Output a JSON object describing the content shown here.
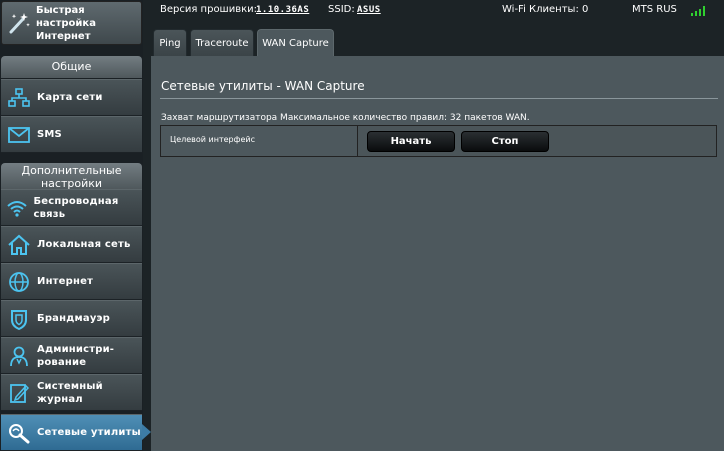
{
  "sidebar": {
    "quick_setup_label": "Быстрая настройка Интернет",
    "general_header": "Общие",
    "general_items": [
      {
        "label": "Карта сети",
        "icon": "network-map-icon"
      },
      {
        "label": "SMS",
        "icon": "envelope-icon"
      }
    ],
    "advanced_header": "Дополнительные настройки",
    "advanced_items": [
      {
        "label": "Беспроводная связь",
        "icon": "wifi-icon"
      },
      {
        "label": "Локальная сеть",
        "icon": "home-icon"
      },
      {
        "label": "Интернет",
        "icon": "globe-icon"
      },
      {
        "label": "Брандмауэр",
        "icon": "shield-icon"
      },
      {
        "label": "Администри-рование",
        "icon": "admin-user-icon"
      },
      {
        "label": "Системный журнал",
        "icon": "log-edit-icon"
      },
      {
        "label": "Сетевые утилиты",
        "icon": "tools-magnifier-icon",
        "active": true
      }
    ]
  },
  "topbar": {
    "firmware_label": "Версия прошивки:",
    "firmware_value": "1.10.36AS",
    "ssid_label": "SSID:",
    "ssid_value": "ASUS",
    "clients_label": "Wi-Fi Клиенты: 0",
    "operator": "MTS RUS",
    "signal_color": "#2fd02f"
  },
  "tabs": [
    {
      "label": "Ping"
    },
    {
      "label": "Traceroute"
    },
    {
      "label": "WAN Capture",
      "active": true
    }
  ],
  "content": {
    "title": "Сетевые утилиты - WAN Capture",
    "description": "Захват маршрутизатора Максимальное количество правил: 32 пакетов WAN.",
    "interface_label": "Целевой интерфейс",
    "start_button": "Начать",
    "stop_button": "Стоп"
  }
}
